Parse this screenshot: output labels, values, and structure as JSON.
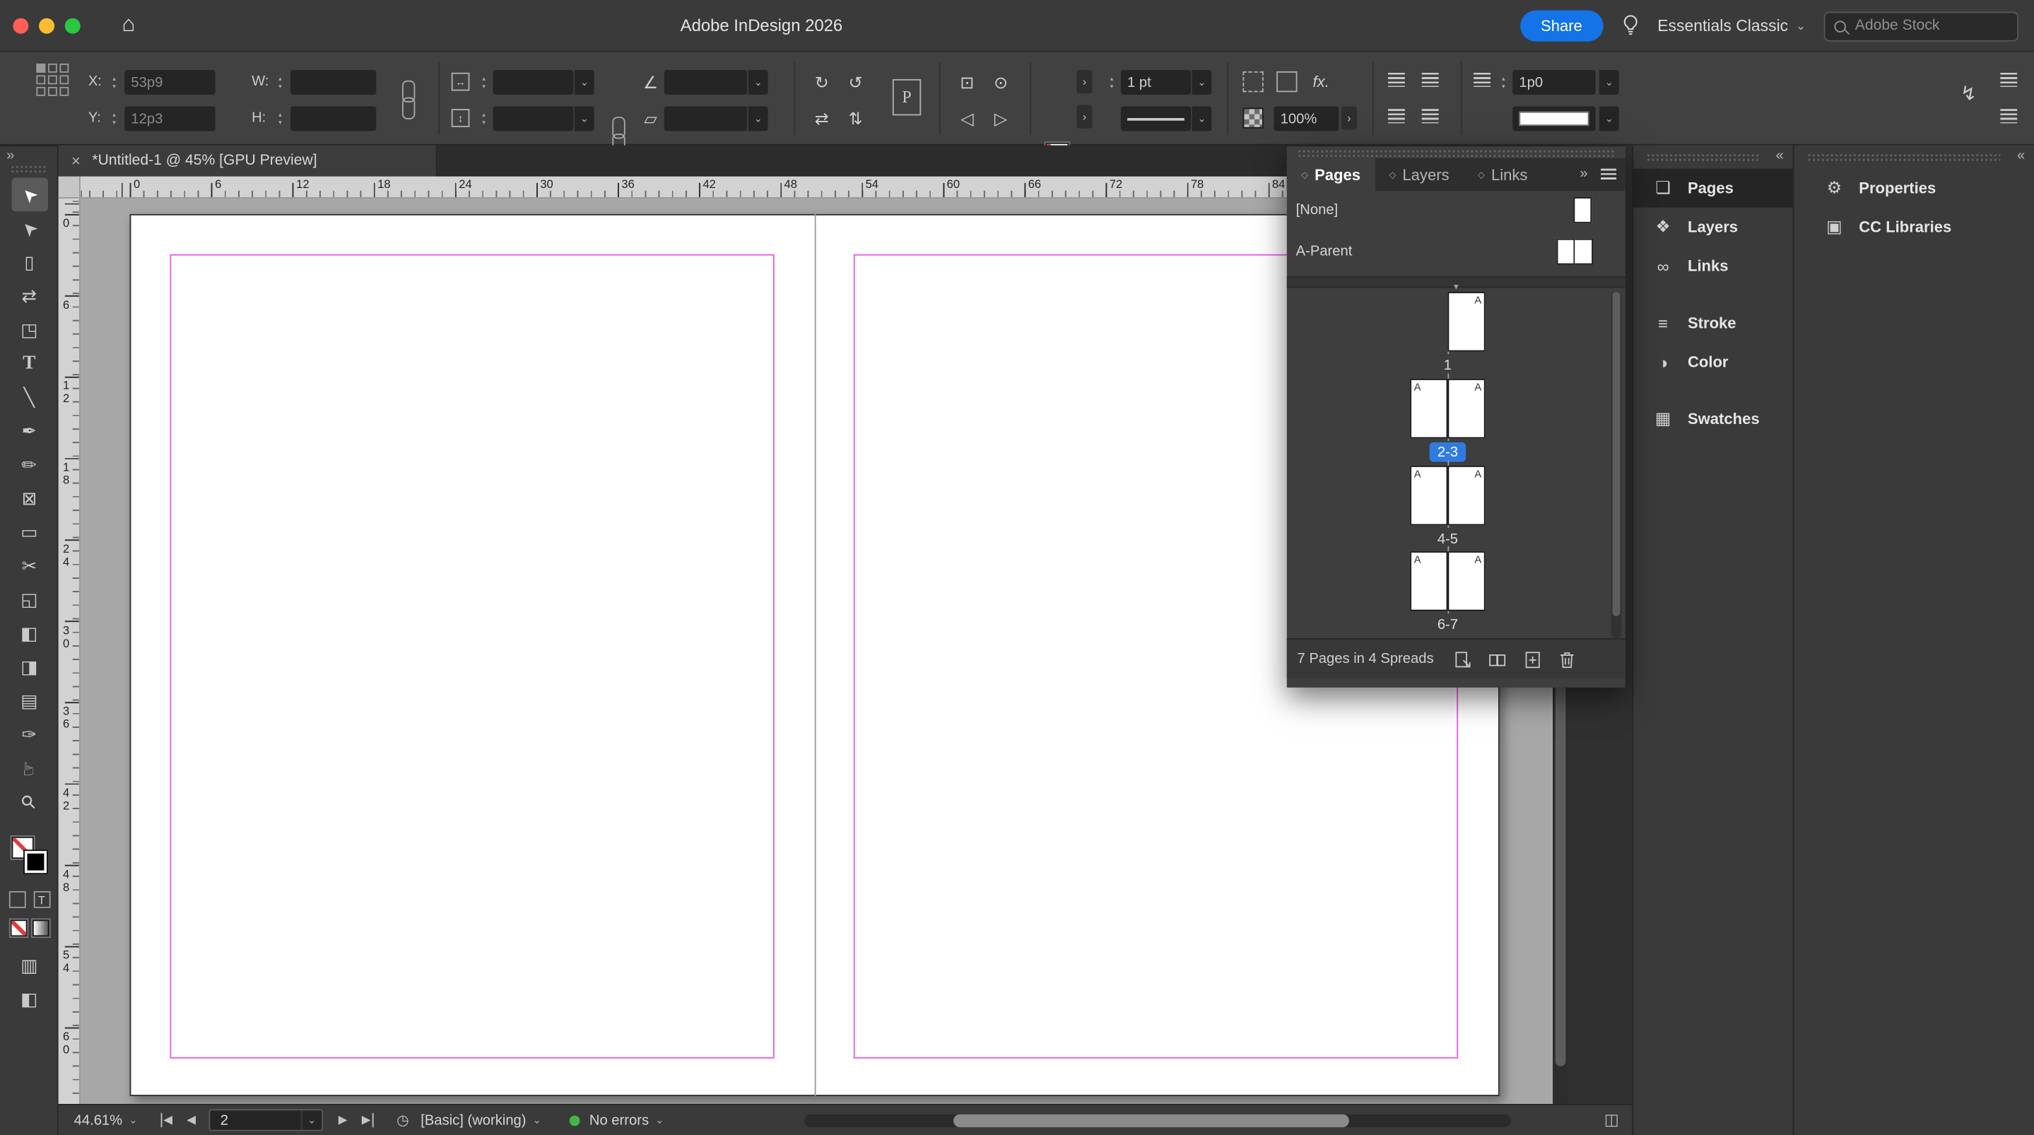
{
  "titlebar": {
    "title": "Adobe InDesign 2026",
    "share_label": "Share",
    "workspace": "Essentials Classic",
    "stock_placeholder": "Adobe Stock"
  },
  "control_bar": {
    "x_label": "X:",
    "x_value": "53p9",
    "y_label": "Y:",
    "y_value": "12p3",
    "w_label": "W:",
    "w_value": "",
    "h_label": "H:",
    "h_value": "",
    "stroke_weight": "1 pt",
    "p_badge": "P",
    "fx_label": "fx.",
    "opacity": "100%",
    "spacing_value": "1p0"
  },
  "doc_tab": {
    "close": "×",
    "title": "*Untitled-1 @ 45% [GPU Preview]"
  },
  "rulers": {
    "horizontal": [
      "0",
      "6",
      "12",
      "18",
      "24",
      "30",
      "36",
      "42",
      "48",
      "54",
      "60",
      "66",
      "72",
      "78",
      "84"
    ],
    "vertical": [
      "0",
      "6",
      "12",
      "18",
      "24",
      "30",
      "36",
      "42",
      "48",
      "54",
      "60"
    ]
  },
  "tools": [
    {
      "name": "selection-tool",
      "g": "➤",
      "gcls": "rot-nw",
      "cls": "active"
    },
    {
      "name": "direct-selection-tool",
      "g": "➤",
      "gcls": "rot-nw"
    },
    {
      "name": "page-tool",
      "g": "▯"
    },
    {
      "name": "gap-tool",
      "g": "⇄"
    },
    {
      "name": "content-collector-tool",
      "g": "◳"
    },
    {
      "name": "type-tool",
      "g": "T",
      "gcls": "serifT"
    },
    {
      "name": "line-tool",
      "g": "╲"
    },
    {
      "name": "pen-tool",
      "g": "✒"
    },
    {
      "name": "pencil-tool",
      "g": "✏"
    },
    {
      "name": "frame-tool",
      "g": "⊠"
    },
    {
      "name": "rectangle-tool",
      "g": "▭"
    },
    {
      "name": "scissors-tool",
      "g": "✂"
    },
    {
      "name": "free-transform-tool",
      "g": "◱"
    },
    {
      "name": "gradient-swatch-tool",
      "g": "◧"
    },
    {
      "name": "gradient-feather-tool",
      "g": "◨"
    },
    {
      "name": "note-tool",
      "g": "▤"
    },
    {
      "name": "eyedropper-tool",
      "g": "✑"
    },
    {
      "name": "hand-tool",
      "g": "☞",
      "gcls": "rot-up"
    },
    {
      "name": "zoom-tool",
      "g": "⚲",
      "gcls": "rot-zoom"
    }
  ],
  "tools2": [
    {
      "name": "screen-mode-normal",
      "g": "▥"
    },
    {
      "name": "screen-mode-preview",
      "g": "◧"
    }
  ],
  "pages_panel": {
    "tabs": [
      {
        "label": "Pages",
        "cls": "active"
      },
      {
        "label": "Layers",
        "cls": ""
      },
      {
        "label": "Links",
        "cls": ""
      }
    ],
    "none_label": "[None]",
    "parent_label": "A-Parent",
    "spreads": [
      {
        "label": "1",
        "cls": "single",
        "sel": "",
        "a": "A"
      },
      {
        "label": "2-3",
        "cls": "",
        "sel": "selected",
        "a": "A"
      },
      {
        "label": "4-5",
        "cls": "",
        "sel": "",
        "a": "A"
      },
      {
        "label": "6-7",
        "cls": "",
        "sel": "",
        "a": "A"
      }
    ],
    "status": "7 Pages in 4 Spreads"
  },
  "dock_primary": [
    {
      "name": "panel-item-pages",
      "icon": "pages-icon",
      "g": "❏",
      "label": "Pages",
      "cls": "active"
    },
    {
      "name": "panel-item-layers",
      "icon": "layers-icon",
      "g": "❖",
      "label": "Layers",
      "cls": ""
    },
    {
      "name": "panel-item-links",
      "icon": "links-icon",
      "g": "∞",
      "label": "Links",
      "cls": ""
    },
    {
      "name": "panel-item-stroke",
      "icon": "stroke-icon",
      "g": "≡",
      "label": "Stroke",
      "cls": "gap"
    },
    {
      "name": "panel-item-color",
      "icon": "color-icon",
      "g": "◑",
      "label": "Color",
      "cls": ""
    },
    {
      "name": "panel-item-swatches",
      "icon": "swatches-icon",
      "g": "▦",
      "label": "Swatches",
      "cls": "gap"
    }
  ],
  "dock_secondary": [
    {
      "name": "panel-item-properties",
      "icon": "properties-icon",
      "g": "⚙",
      "label": "Properties",
      "cls": ""
    },
    {
      "name": "panel-item-cc-libraries",
      "icon": "cc-libraries-icon",
      "g": "▣",
      "label": "CC Libraries",
      "cls": ""
    }
  ],
  "statusbar": {
    "zoom": "44.61%",
    "page_value": "2",
    "preflight_profile": "[Basic] (working)",
    "preflight_status": "No errors"
  },
  "icons": {
    "chevron_down": "⌄",
    "flyout_right": "›",
    "collapse_left": "«",
    "expand_right": "»",
    "prev": "◀",
    "next": "▶",
    "rotate_cw": "↻",
    "rotate_ccw": "↺",
    "flip_h": "⇄",
    "flip_v": "⇅",
    "home": "⌂",
    "bolt": "↯",
    "split_view": "◫",
    "clock": "◷",
    "divider_handle": "▾",
    "rotation_angle": "∠",
    "shear_angle": "▱",
    "scale_h": "↔",
    "scale_v": "↕",
    "select_container": "⊡",
    "select_content": "⊙",
    "select_prev": "◁",
    "select_next": "▷",
    "stepper_up": "▴",
    "stepper_down": "▾",
    "tab_marker": "◇",
    "formatting_text": "T"
  },
  "colors": {
    "accent_blue": "#1473e6",
    "selection_blue": "#2f7ce0",
    "margin_guide_magenta": "#ea5bea",
    "no_error_green": "#43b64a",
    "traffic_red": "#ff5f57",
    "traffic_yellow": "#febc2e",
    "traffic_green": "#28c840"
  }
}
